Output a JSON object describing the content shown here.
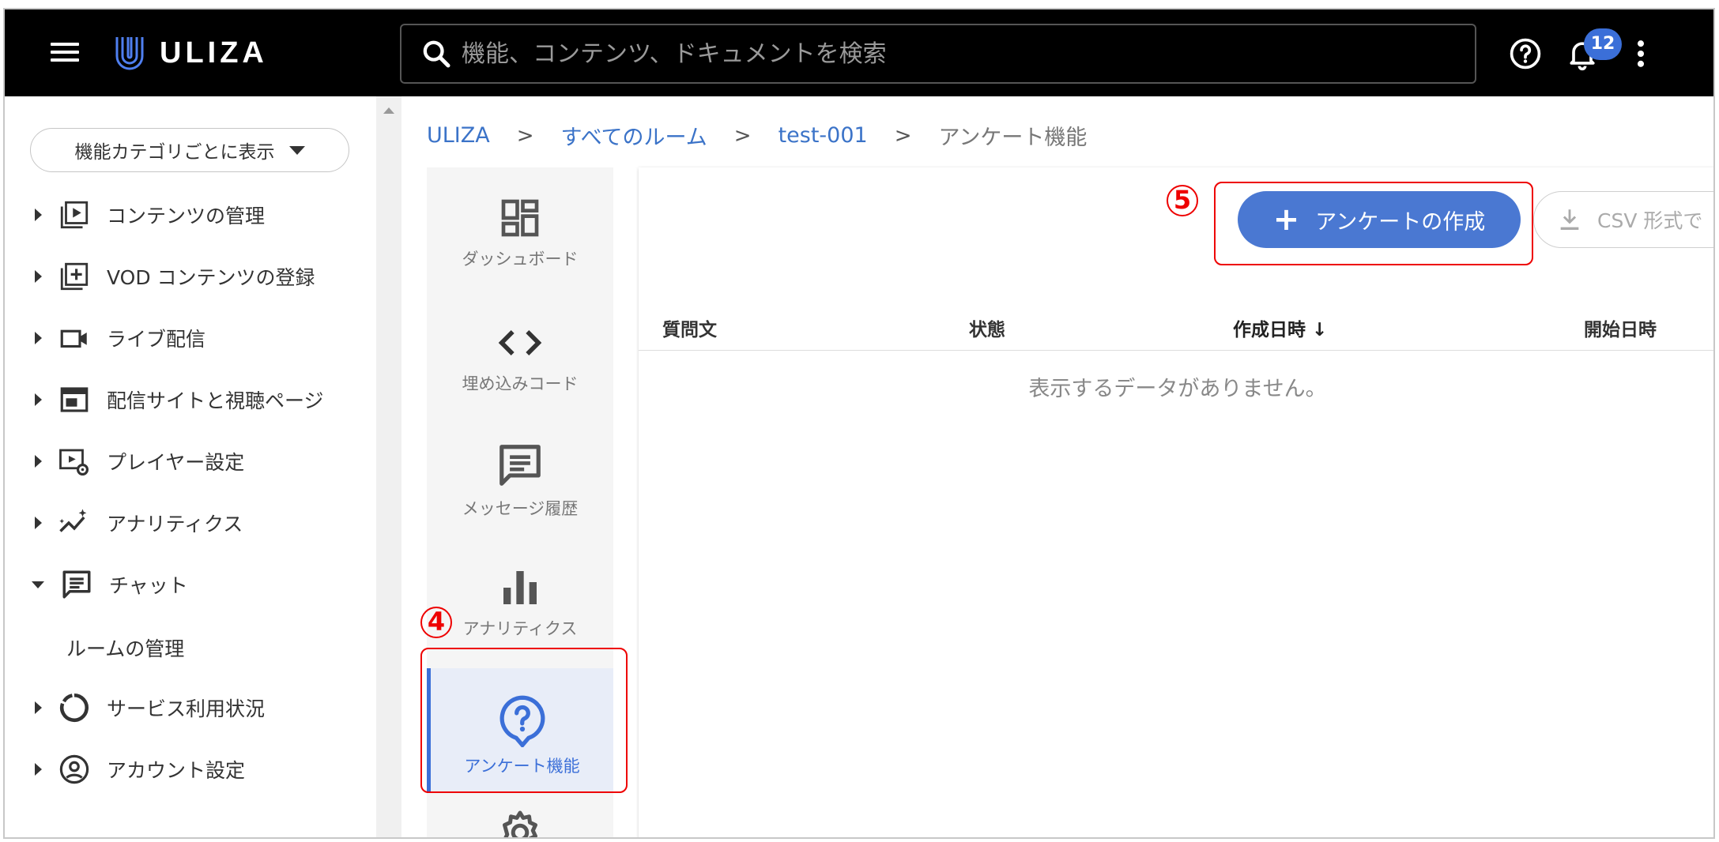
{
  "header": {
    "logo_text": "ULIZA",
    "search_placeholder": "機能、コンテンツ、ドキュメントを検索",
    "notification_count": "12"
  },
  "sidebar": {
    "category_select": "機能カテゴリごとに表示",
    "items": [
      {
        "label": "コンテンツの管理",
        "icon": "content-manage-icon"
      },
      {
        "label": "VOD コンテンツの登録",
        "icon": "vod-register-icon"
      },
      {
        "label": "ライブ配信",
        "icon": "live-camera-icon"
      },
      {
        "label": "配信サイトと視聴ページ",
        "icon": "site-page-icon"
      },
      {
        "label": "プレイヤー設定",
        "icon": "player-settings-icon"
      },
      {
        "label": "アナリティクス",
        "icon": "analytics-icon"
      },
      {
        "label": "チャット",
        "icon": "chat-icon"
      },
      {
        "label": "サービス利用状況",
        "icon": "service-usage-icon"
      },
      {
        "label": "アカウント設定",
        "icon": "account-icon"
      }
    ],
    "sub_item": "ルームの管理"
  },
  "breadcrumb": {
    "items": [
      "ULIZA",
      "すべてのルーム",
      "test-001"
    ],
    "current": "アンケート機能",
    "separator": ">"
  },
  "inner_nav": {
    "items": [
      {
        "label": "ダッシュボード",
        "icon": "dashboard-icon"
      },
      {
        "label": "埋め込みコード",
        "icon": "code-icon"
      },
      {
        "label": "メッセージ履歴",
        "icon": "message-icon"
      },
      {
        "label": "アナリティクス",
        "icon": "bar-chart-icon"
      },
      {
        "label": "アンケート機能",
        "icon": "survey-icon"
      }
    ],
    "active": "アンケート機能"
  },
  "panel": {
    "create_button": "アンケートの作成",
    "csv_button": "CSV 形式で",
    "columns": [
      "質問文",
      "状態",
      "作成日時",
      "開始日時"
    ],
    "sorted_column": "作成日時",
    "sort_arrow": "↓",
    "empty_message": "表示するデータがありません。"
  },
  "annotations": {
    "step4": "4",
    "step5": "5"
  },
  "colors": {
    "accent": "#3b6fd8",
    "header_bg": "#000000",
    "callout": "#e00000"
  }
}
